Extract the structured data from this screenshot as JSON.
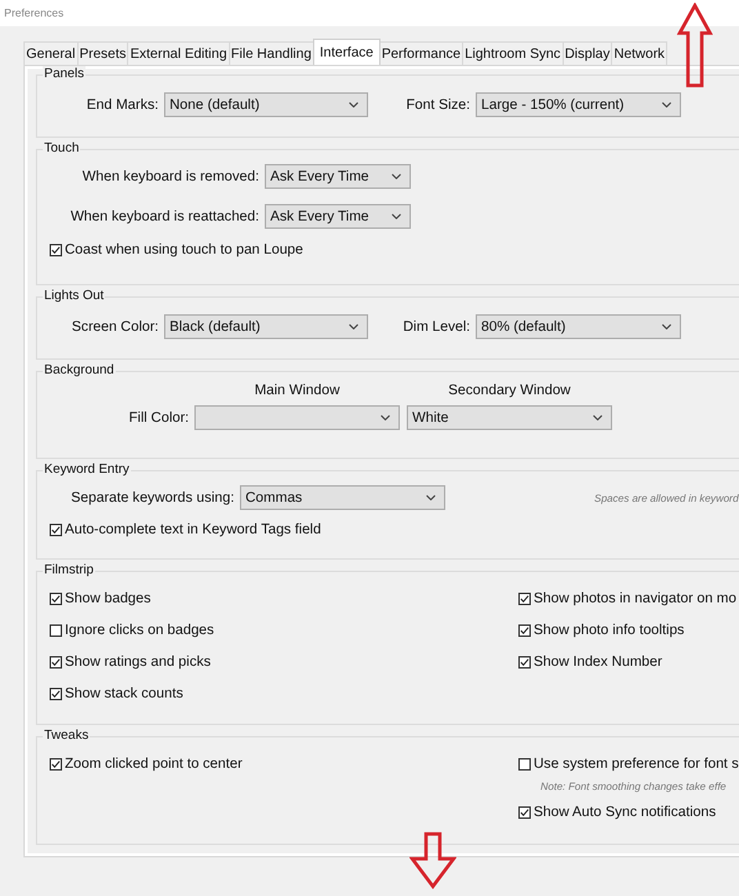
{
  "window": {
    "title": "Preferences"
  },
  "tabs": [
    {
      "label": "General",
      "selected": false
    },
    {
      "label": "Presets",
      "selected": false
    },
    {
      "label": "External Editing",
      "selected": false
    },
    {
      "label": "File Handling",
      "selected": false
    },
    {
      "label": "Interface",
      "selected": true
    },
    {
      "label": "Performance",
      "selected": false
    },
    {
      "label": "Lightroom Sync",
      "selected": false
    },
    {
      "label": "Display",
      "selected": false
    },
    {
      "label": "Network",
      "selected": false
    }
  ],
  "panels": {
    "title": "Panels",
    "end_marks": {
      "label": "End Marks:",
      "value": "None (default)"
    },
    "font_size": {
      "label": "Font Size:",
      "value": "Large - 150% (current)"
    }
  },
  "touch": {
    "title": "Touch",
    "dropdowns": [
      {
        "label": "When keyboard is removed:",
        "value": "Ask Every Time"
      },
      {
        "label": "When keyboard is reattached:",
        "value": "Ask Every Time"
      }
    ],
    "checkboxes": [
      {
        "label": "Coast when using touch to pan Loupe",
        "checked": true
      }
    ]
  },
  "lights_out": {
    "title": "Lights Out",
    "screen_color": {
      "label": "Screen Color:",
      "value": "Black (default)"
    },
    "dim_level": {
      "label": "Dim Level:",
      "value": "80% (default)"
    }
  },
  "background": {
    "title": "Background",
    "label": "Fill Color:",
    "main_window": {
      "heading": "Main Window"
    },
    "secondary_window": {
      "heading": "Secondary Window",
      "value": "White"
    }
  },
  "keyword_entry": {
    "title": "Keyword Entry",
    "separator": {
      "label": "Separate keywords using:",
      "value": "Commas"
    },
    "note": "Spaces are allowed in keyword",
    "checkboxes": [
      {
        "label": "Auto-complete text in Keyword Tags field",
        "checked": true
      }
    ]
  },
  "filmstrip": {
    "title": "Filmstrip",
    "left": [
      {
        "label": "Show badges",
        "checked": true
      },
      {
        "label": "Ignore clicks on badges",
        "checked": false
      },
      {
        "label": "Show ratings and picks",
        "checked": true
      },
      {
        "label": "Show stack counts",
        "checked": true
      }
    ],
    "right": [
      {
        "label": "Show photos in navigator on mo",
        "checked": true
      },
      {
        "label": "Show photo info tooltips",
        "checked": true
      },
      {
        "label": "Show Index Number",
        "checked": true
      }
    ]
  },
  "tweaks": {
    "title": "Tweaks",
    "left": [
      {
        "kind": "checkbox",
        "label": "Zoom clicked point to center",
        "checked": true
      }
    ],
    "right": [
      {
        "kind": "checkbox",
        "label": "Use system preference for font s",
        "checked": false
      },
      {
        "kind": "note",
        "text": "Note: Font smoothing changes take effe"
      },
      {
        "kind": "checkbox",
        "label": "Show Auto Sync notifications",
        "checked": true
      }
    ]
  }
}
